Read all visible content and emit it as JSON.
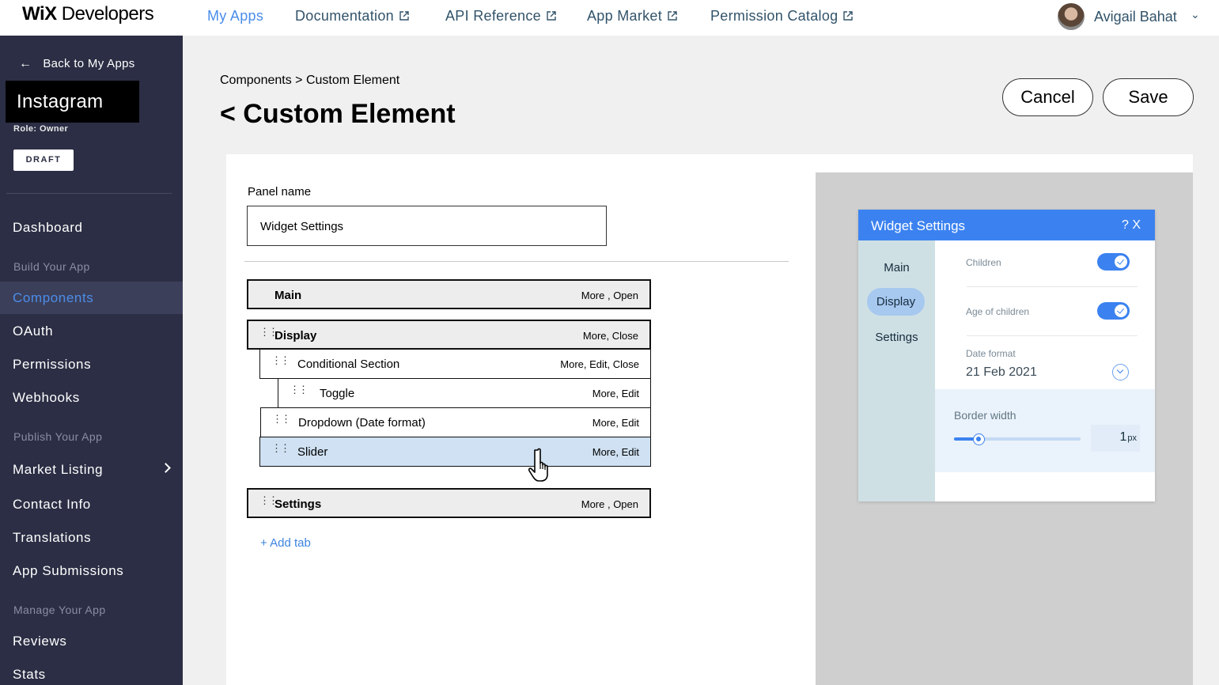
{
  "brand": {
    "logo_bold": "WiX",
    "logo_rest": " Developers"
  },
  "topnav": {
    "links": [
      {
        "label": "My Apps",
        "active": true
      },
      {
        "label": "Documentation",
        "external": true
      },
      {
        "label": "API Reference",
        "external": true
      },
      {
        "label": "App Market",
        "external": true
      },
      {
        "label": "Permission Catalog",
        "external": true
      }
    ],
    "user": {
      "name": "Avigail Bahat"
    }
  },
  "sidebar": {
    "back_label": "Back to My Apps",
    "app_name": "Instagram",
    "role": "Role: Owner",
    "status_badge": "DRAFT",
    "items": {
      "dashboard": "Dashboard",
      "section_build": "Build Your App",
      "components": "Components",
      "oauth": "OAuth",
      "permissions": "Permissions",
      "webhooks": "Webhooks",
      "section_publish": "Publish Your App",
      "market_listing": "Market Listing",
      "contact_info": "Contact Info",
      "translations": "Translations",
      "app_submissions": "App Submissions",
      "section_manage": "Manage Your App",
      "reviews": "Reviews",
      "stats": "Stats"
    },
    "active_item": "Components"
  },
  "header": {
    "breadcrumb": "Components > Custom Element",
    "title": "< Custom Element",
    "cancel_label": "Cancel",
    "save_label": "Save"
  },
  "editor": {
    "panel_name_label": "Panel name",
    "panel_name_value": "Widget Settings",
    "tabs": [
      {
        "label": "Main",
        "actions": "More , Open"
      },
      {
        "label": "Display",
        "actions": "More, Close"
      },
      {
        "label": "Conditional Section",
        "actions": "More, Edit, Close"
      },
      {
        "label": "Toggle",
        "actions": "More, Edit"
      },
      {
        "label": "Dropdown (Date format)",
        "actions": "More, Edit"
      },
      {
        "label": "Slider",
        "actions": "More, Edit"
      },
      {
        "label": "Settings",
        "actions": "More , Open"
      }
    ],
    "add_tab_label": "+ Add tab"
  },
  "preview": {
    "panel_title": "Widget Settings",
    "header_icons": "? X",
    "tabs": [
      "Main",
      "Display",
      "Settings"
    ],
    "active_tab": "Display",
    "children_label": "Children",
    "children_on": true,
    "age_label": "Age of children",
    "age_on": true,
    "date_format_label": "Date format",
    "date_format_value": "21 Feb 2021",
    "border_width_label": "Border width",
    "border_width_value": "1",
    "border_width_unit": "px",
    "border_width_fraction": 0.2
  },
  "colors": {
    "sidebar_bg": "#2b2e44",
    "accent": "#3b82f0",
    "nav_active": "#4b8de9",
    "selected_row": "#cfe1f2"
  }
}
